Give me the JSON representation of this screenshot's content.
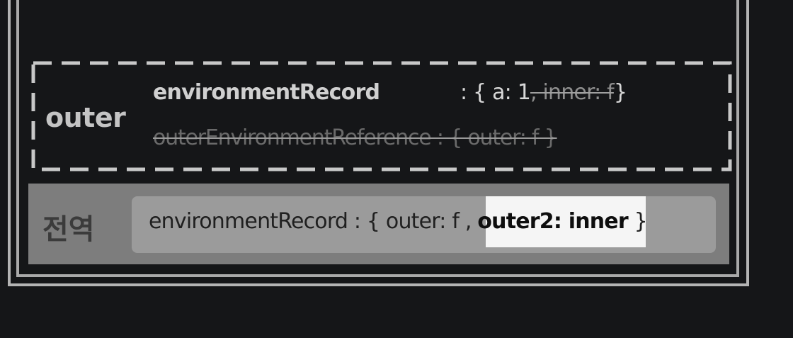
{
  "outer_context": {
    "label": "outer",
    "environment_record_key": "environmentRecord",
    "environment_record_value": ": { a: 1",
    "environment_record_struck": ", inner: f",
    "environment_record_close": "}",
    "outer_environment_reference": "outerEnvironmentReference : { outer: f }"
  },
  "global_context": {
    "label": "전역",
    "environment_record_prefix": "environmentRecord : { outer: f ,",
    "highlighted_entry": "outer2: inner",
    "close": "}"
  },
  "colors": {
    "background": "#151618",
    "frame": "#b4b4b4",
    "dashed_border": "#c8c8c8",
    "global_panel": "#7d7d7d",
    "global_record": "#9b9b9b",
    "highlight": "#f5f5f5"
  }
}
